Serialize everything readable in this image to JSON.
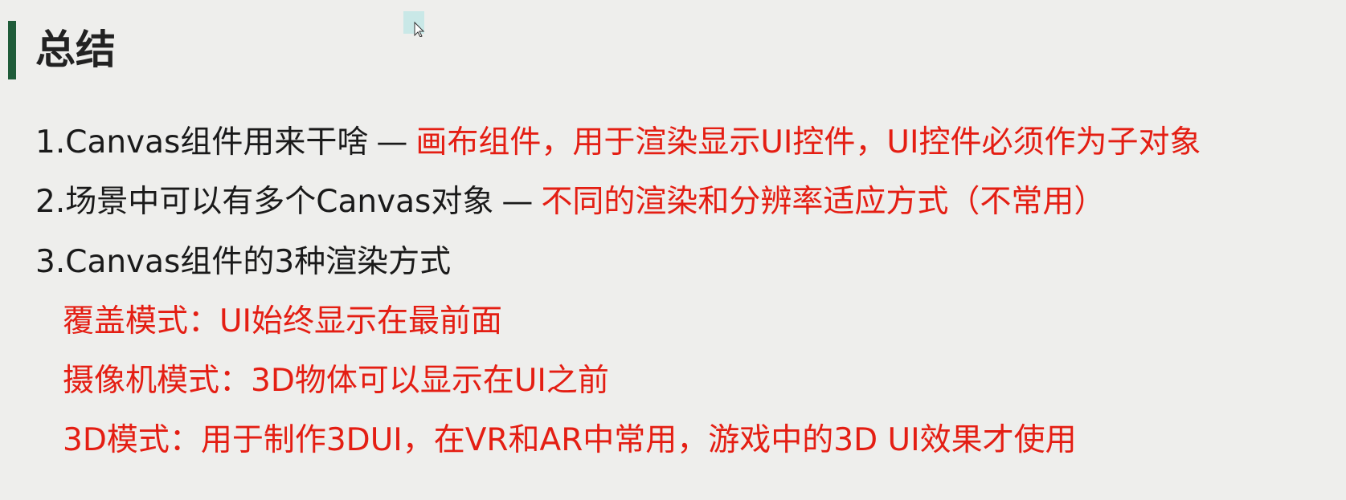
{
  "title": "总结",
  "colors": {
    "accent_bar": "#1f5c3a",
    "highlight": "#e41e13",
    "text": "#1a1a1a",
    "background": "#eeeeec"
  },
  "items": [
    {
      "label": "1.Canvas组件用来干啥",
      "separator": "—",
      "note": "画布组件，用于渲染显示UI控件，UI控件必须作为子对象"
    },
    {
      "label": "2.场景中可以有多个Canvas对象",
      "separator": "—",
      "note": "不同的渲染和分辨率适应方式（不常用）"
    },
    {
      "label": "3.Canvas组件的3种渲染方式"
    }
  ],
  "modes": [
    "覆盖模式：UI始终显示在最前面",
    "摄像机模式：3D物体可以显示在UI之前",
    "3D模式：用于制作3DUI，在VR和AR中常用，游戏中的3D UI效果才使用"
  ],
  "cursor_icon": "mouse-pointer-icon"
}
